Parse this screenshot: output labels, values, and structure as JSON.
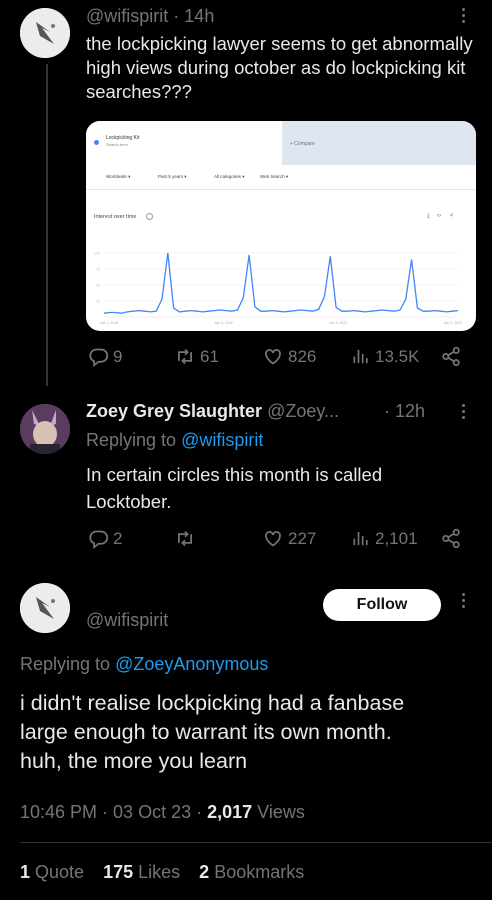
{
  "tweet1": {
    "handle": "@wifispirit",
    "time": "· 14h",
    "text": "the lockpicking lawyer seems to get abnormally high views during october as do lockpicking kit searches???",
    "image": {
      "search_term": "Lockpicking Kit",
      "search_sub": "Search term",
      "compare": "+ Compare",
      "filters": [
        "Worldwide ▾",
        "Past 5 years ▾",
        "All categories ▾",
        "Web Search ▾"
      ],
      "interest_label": "Interest over time",
      "x_ticks": [
        "Oct 1, 2018",
        "Apr 5, 2020",
        "Oct 9, 2021",
        "Apr 2, 2023"
      ],
      "y_ticks": [
        "100",
        "75",
        "50",
        "25"
      ],
      "line_color": "#4285f4",
      "chart_data": {
        "type": "line",
        "title": "",
        "xlabel": "",
        "ylabel": "",
        "ylim": [
          0,
          100
        ],
        "series": [
          {
            "values": [
              6,
              7,
              7,
              6,
              8,
              9,
              10,
              9,
              8,
              9,
              28,
              100,
              14,
              8,
              9,
              10,
              9,
              8,
              9,
              10,
              11,
              10,
              9,
              11,
              30,
              97,
              16,
              9,
              9,
              10,
              9,
              8,
              9,
              10,
              11,
              10,
              9,
              12,
              32,
              95,
              15,
              9,
              9,
              10,
              9,
              8,
              9,
              10,
              11,
              10,
              9,
              11,
              28,
              90,
              14,
              9,
              9,
              10,
              9,
              8,
              9,
              10
            ]
          }
        ]
      }
    },
    "actions": {
      "replies": "9",
      "retweets": "61",
      "likes": "826",
      "views": "13.5K"
    }
  },
  "tweet2": {
    "name": "Zoey Grey Slaughter",
    "handle": "@Zoey...",
    "time": "· 12h",
    "replying_prefix": "Replying to ",
    "replying_to": "@wifispirit",
    "text_line1": "In certain circles this month is called",
    "text_line2": "Locktober.",
    "actions": {
      "replies": "2",
      "retweets": "",
      "likes": "227",
      "views": "2,101"
    }
  },
  "tweet3": {
    "handle": "@wifispirit",
    "follow_label": "Follow",
    "replying_prefix": "Replying to ",
    "replying_to": "@ZoeyAnonymous",
    "text_line1": "i didn't realise lockpicking had a fanbase",
    "text_line2": "large enough to warrant its own month.",
    "text_line3": "huh, the more you learn",
    "timestamp": "10:46 PM · 03 Oct 23 · ",
    "views_count": "2,017",
    "views_label": " Views",
    "stats": {
      "quotes_count": "1",
      "quotes_label": " Quote",
      "likes_count": "175",
      "likes_label": " Likes",
      "bookmarks_count": "2",
      "bookmarks_label": " Bookmarks"
    }
  },
  "colors": {
    "background": "#000000",
    "text": "#e7e9ea",
    "muted": "#71767b",
    "link": "#1d9bf0",
    "divider": "#2f3336"
  }
}
